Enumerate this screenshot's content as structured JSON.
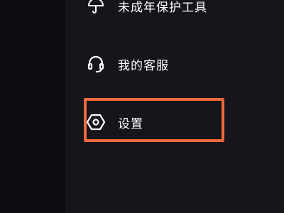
{
  "menu": {
    "items": [
      {
        "label": "未成年保护工具",
        "icon": "umbrella-icon"
      },
      {
        "label": "我的客服",
        "icon": "headset-icon"
      },
      {
        "label": "设置",
        "icon": "hexagon-settings-icon"
      }
    ],
    "highlighted_item": "设置"
  },
  "colors": {
    "background": "#15151b",
    "text": "#ffffff",
    "highlight": "#f0693c"
  }
}
